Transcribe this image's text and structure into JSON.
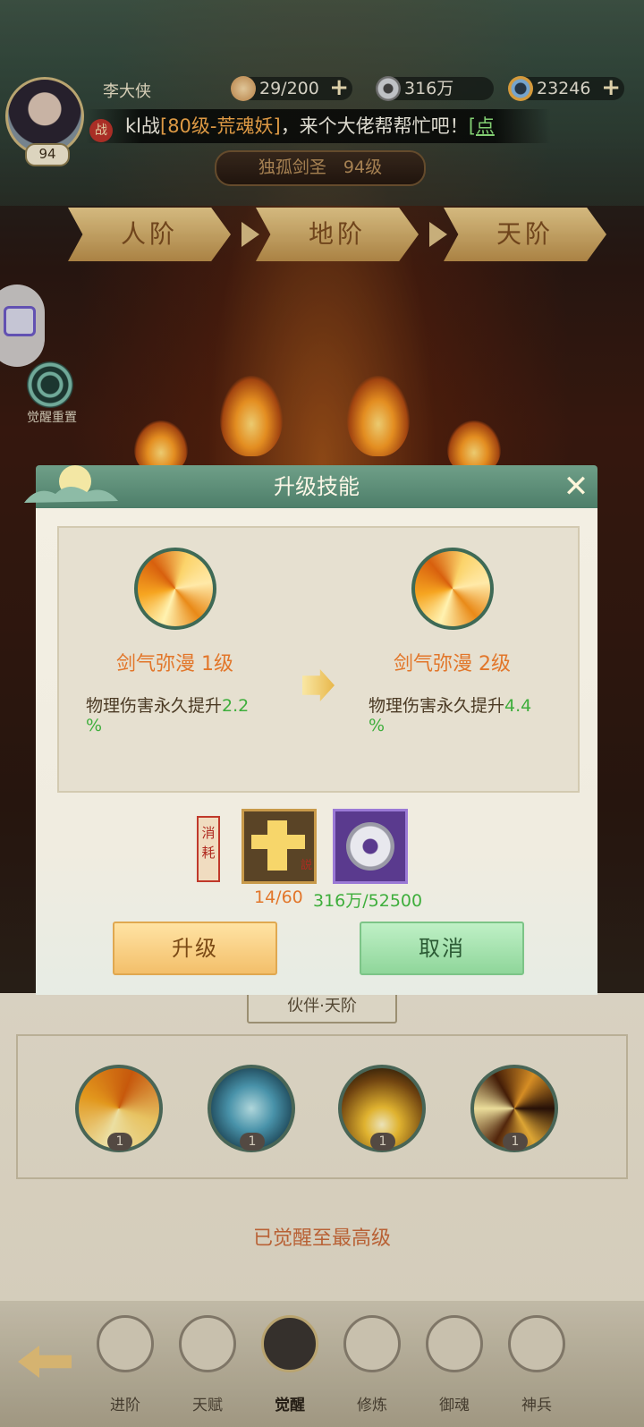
{
  "header": {
    "player_name": "李大侠",
    "player_level": "94",
    "resources": [
      {
        "icon": "bun-icon",
        "value": "29/200"
      },
      {
        "icon": "coin-icon",
        "value": "316万"
      },
      {
        "icon": "jade-icon",
        "value": "23246"
      }
    ],
    "ticker": {
      "battle_tag": "战",
      "prefix": "kl战",
      "highlight": "[80级-荒魂妖]",
      "middle": "，来个大佬帮帮忙吧！",
      "link": "[点"
    },
    "character_title": "独孤剑圣　94级"
  },
  "tiers": [
    "人阶",
    "地阶",
    "天阶"
  ],
  "side": {
    "awaken_reset_label": "觉醒重置"
  },
  "dialog": {
    "title": "升级技能",
    "close_label": "✕",
    "current": {
      "name": "剑气弥漫 1级",
      "desc_prefix": "物理伤害永久提升",
      "desc_value": "2.2",
      "desc_suffix": "%"
    },
    "next": {
      "name": "剑气弥漫 2级",
      "desc_prefix": "物理伤害永久提升",
      "desc_value": "4.4",
      "desc_suffix": "%"
    },
    "cost_label": "消耗",
    "costs": [
      {
        "item": "manual",
        "badge": "説",
        "amount": "14/60"
      },
      {
        "item": "copper-coin",
        "amount": "316万/52500"
      }
    ],
    "upgrade_button": "升级",
    "cancel_button": "取消"
  },
  "partner_section": {
    "title": "伙伴·天阶",
    "skills": [
      {
        "icon": "sword-light-skill-icon",
        "level": "1"
      },
      {
        "icon": "spirit-hand-skill-icon",
        "level": "1"
      },
      {
        "icon": "golden-blade-skill-icon",
        "level": "1"
      },
      {
        "icon": "sword-storm-skill-icon",
        "level": "1"
      }
    ],
    "max_note": "已觉醒至最高级"
  },
  "bottom_nav": [
    {
      "label": "进阶",
      "icon": "person-icon"
    },
    {
      "label": "天赋",
      "icon": "book-icon"
    },
    {
      "label": "觉醒",
      "icon": "stars-icon",
      "active": true
    },
    {
      "label": "修炼",
      "icon": "meditate-icon"
    },
    {
      "label": "御魂",
      "icon": "soul-icon"
    },
    {
      "label": "神兵",
      "icon": "weapon-icon"
    }
  ],
  "colors": {
    "accent_orange": "#e2762a",
    "accent_green": "#3eae3c",
    "dialog_header": "#5e8f78"
  }
}
